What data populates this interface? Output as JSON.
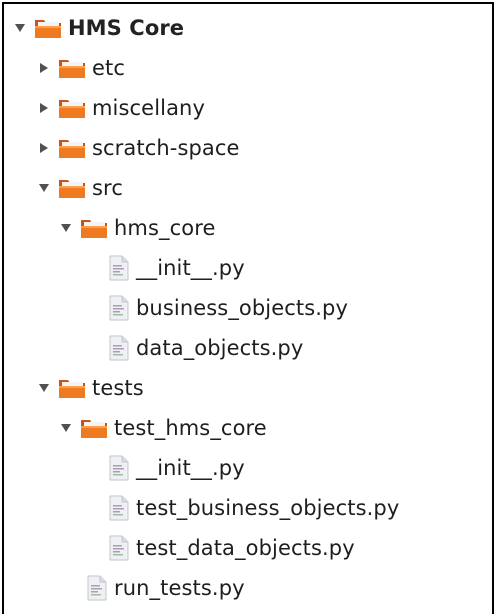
{
  "tree": {
    "root": {
      "label": "HMS Core",
      "icon": "folder-icon",
      "expanded": true
    },
    "etc": {
      "label": "etc",
      "icon": "folder-icon",
      "expanded": false
    },
    "miscellany": {
      "label": "miscellany",
      "icon": "folder-icon",
      "expanded": false
    },
    "scratch_space": {
      "label": "scratch-space",
      "icon": "folder-icon",
      "expanded": false
    },
    "src": {
      "label": "src",
      "icon": "folder-icon",
      "expanded": true
    },
    "hms_core": {
      "label": "hms_core",
      "icon": "folder-icon",
      "expanded": true
    },
    "src_init": {
      "label": "__init__.py",
      "icon": "python-file-icon"
    },
    "business_objects": {
      "label": "business_objects.py",
      "icon": "python-file-icon"
    },
    "data_objects": {
      "label": "data_objects.py",
      "icon": "python-file-icon"
    },
    "tests": {
      "label": "tests",
      "icon": "folder-icon",
      "expanded": true
    },
    "test_hms_core": {
      "label": "test_hms_core",
      "icon": "folder-icon",
      "expanded": true
    },
    "tests_init": {
      "label": "__init__.py",
      "icon": "python-file-icon"
    },
    "test_business_objects": {
      "label": "test_business_objects.py",
      "icon": "python-file-icon"
    },
    "test_data_objects": {
      "label": "test_data_objects.py",
      "icon": "python-file-icon"
    },
    "run_tests": {
      "label": "run_tests.py",
      "icon": "python-file-icon"
    }
  },
  "colors": {
    "folder_front": "#f07a1f",
    "folder_back": "#c9541a",
    "folder_paper": "#f4f4f4",
    "arrow": "#505050",
    "file_page": "#eef0f3"
  }
}
